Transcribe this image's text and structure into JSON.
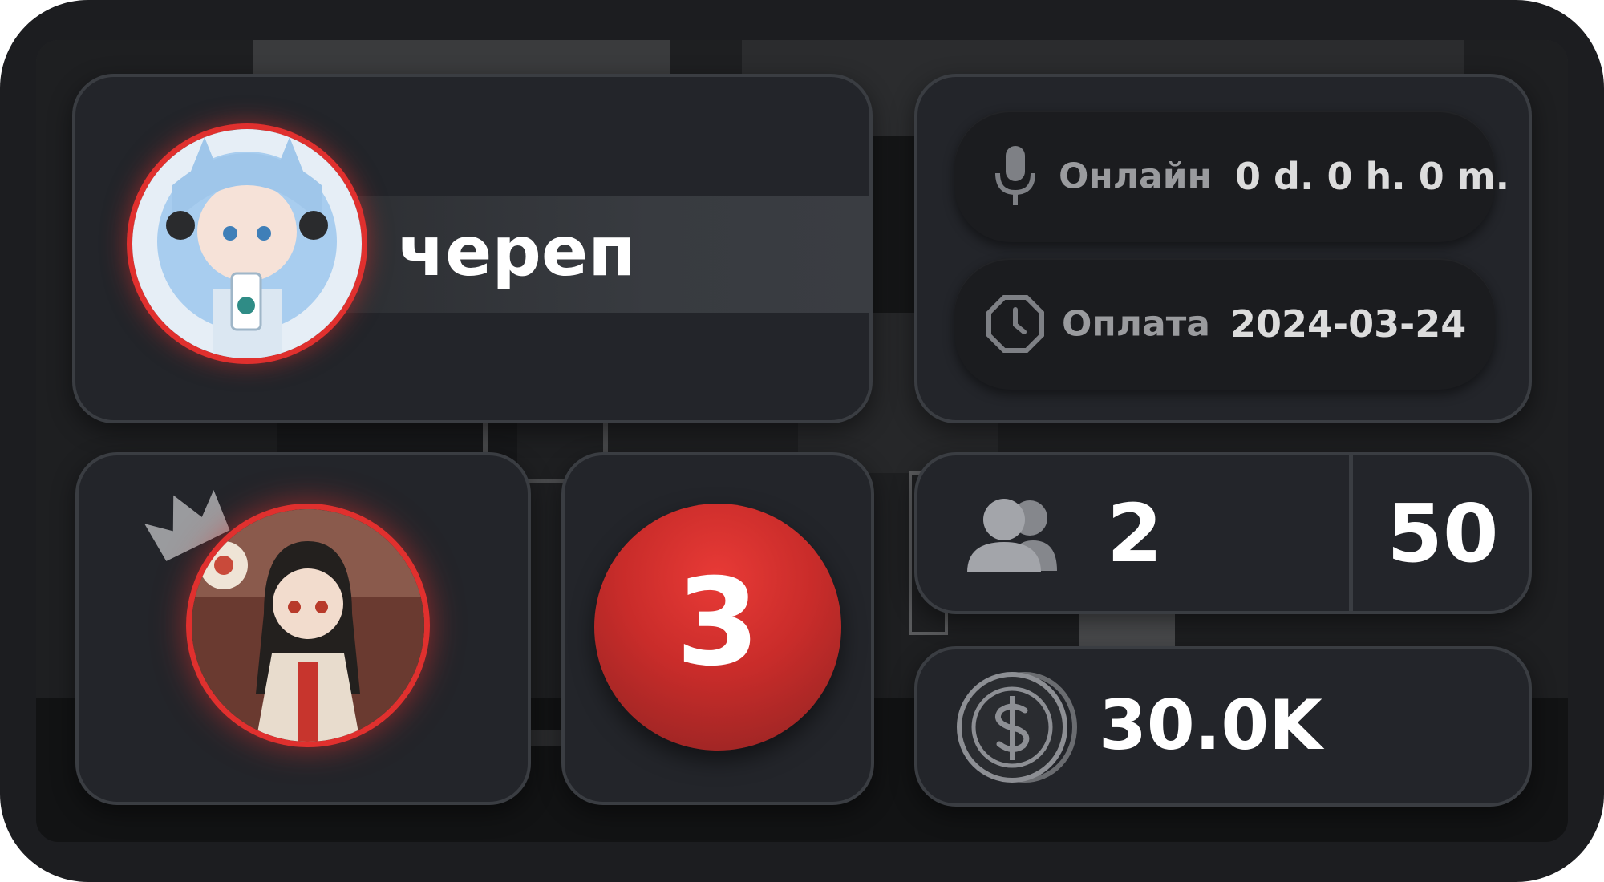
{
  "profile": {
    "username": "череп",
    "avatar_alt": "аватар"
  },
  "stats": {
    "online_label": "Онлайн",
    "online_value": "0 d. 0 h. 0 m.",
    "payment_label": "Оплата",
    "payment_value": "2024-03-24"
  },
  "members": {
    "current": "2",
    "limit": "50"
  },
  "owner": {
    "icon": "crown-icon"
  },
  "rank": {
    "value": "3"
  },
  "balance": {
    "value": "30.0K"
  },
  "colors": {
    "accent_red": "#d8302f",
    "card_bg": "#23252a",
    "text_white": "#ffffff"
  }
}
